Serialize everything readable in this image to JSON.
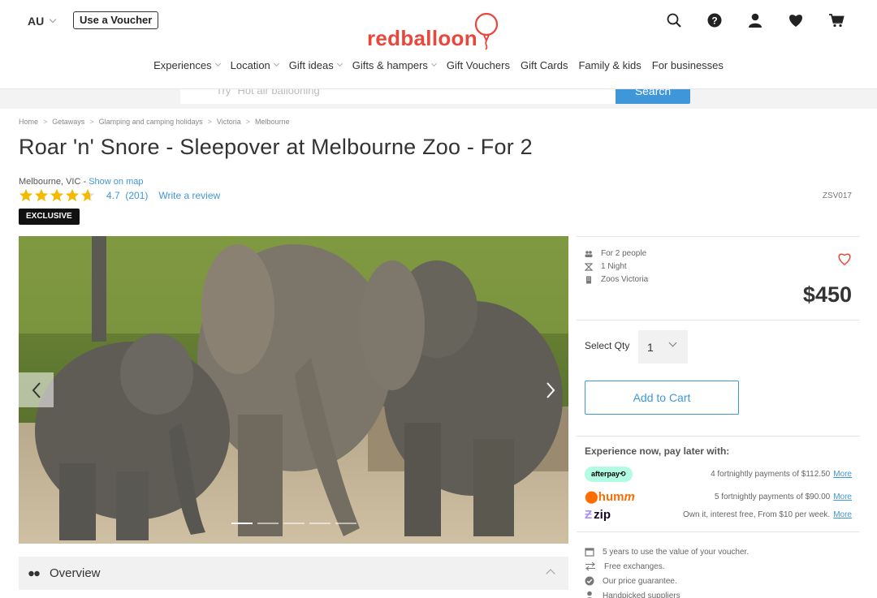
{
  "header": {
    "country": "AU",
    "voucher_btn": "Use a Voucher",
    "logo_text": "redballoon",
    "nav": [
      "Experiences",
      "Location",
      "Gift ideas",
      "Gifts & hampers",
      "Gift Vouchers",
      "Gift Cards",
      "Family & kids",
      "For businesses"
    ],
    "nav_dropdowns": [
      true,
      true,
      true,
      true,
      false,
      false,
      false,
      false
    ],
    "icons": [
      "search-icon",
      "help-icon",
      "account-icon",
      "wishlist-heart-icon",
      "cart-icon"
    ]
  },
  "search": {
    "placeholder": "Try \"Hot air ballooning\"",
    "button": "Search"
  },
  "breadcrumb": [
    "Home",
    "Getaways",
    "Glamping and camping holidays",
    "Victoria",
    "Melbourne"
  ],
  "product": {
    "title": "Roar 'n' Snore - Sleepover at Melbourne Zoo - For 2",
    "location": "Melbourne, VIC",
    "location_sep": " - ",
    "show_on_map": "Show on map",
    "rating": 4.7,
    "rating_text": "4.7",
    "review_count": "(201)",
    "stars_out_of": 5,
    "write_review": "Write a review",
    "sku": "ZSV017",
    "badge": "EXCLUSIVE",
    "gallery_slides": 5,
    "gallery_active": 0
  },
  "details": {
    "people": "For 2 people",
    "duration": "1 Night",
    "supplier": "Zoos Victoria",
    "price": "$450"
  },
  "purchase": {
    "qty_label": "Select Qty",
    "qty_value": "1",
    "add_to_cart": "Add to Cart"
  },
  "payments": {
    "heading": "Experience now, pay later with:",
    "options": [
      {
        "name": "afterpay",
        "logo": "afterpay",
        "desc": "4 fortnightly payments of $112.50",
        "more": "More"
      },
      {
        "name": "humm",
        "logo": "humm",
        "desc": "5 fortnightly payments of $90.00",
        "more": "More"
      },
      {
        "name": "zip",
        "logo": "zip",
        "desc": "Own it, interest free, From $10 per week.",
        "more": "More"
      }
    ]
  },
  "benefits": [
    {
      "icon": "calendar-icon",
      "text": "5 years to use the value of your voucher."
    },
    {
      "icon": "exchange-icon",
      "text": "Free exchanges."
    },
    {
      "icon": "check-circle-icon",
      "text": "Our price guarantee."
    },
    {
      "icon": "person-icon",
      "text": "Handpicked suppliers"
    }
  ],
  "overview": {
    "label": "Overview"
  },
  "colors": {
    "brand_red": "#e8473c",
    "link_blue": "#3f97d9",
    "star_gold": "#f5b900"
  }
}
